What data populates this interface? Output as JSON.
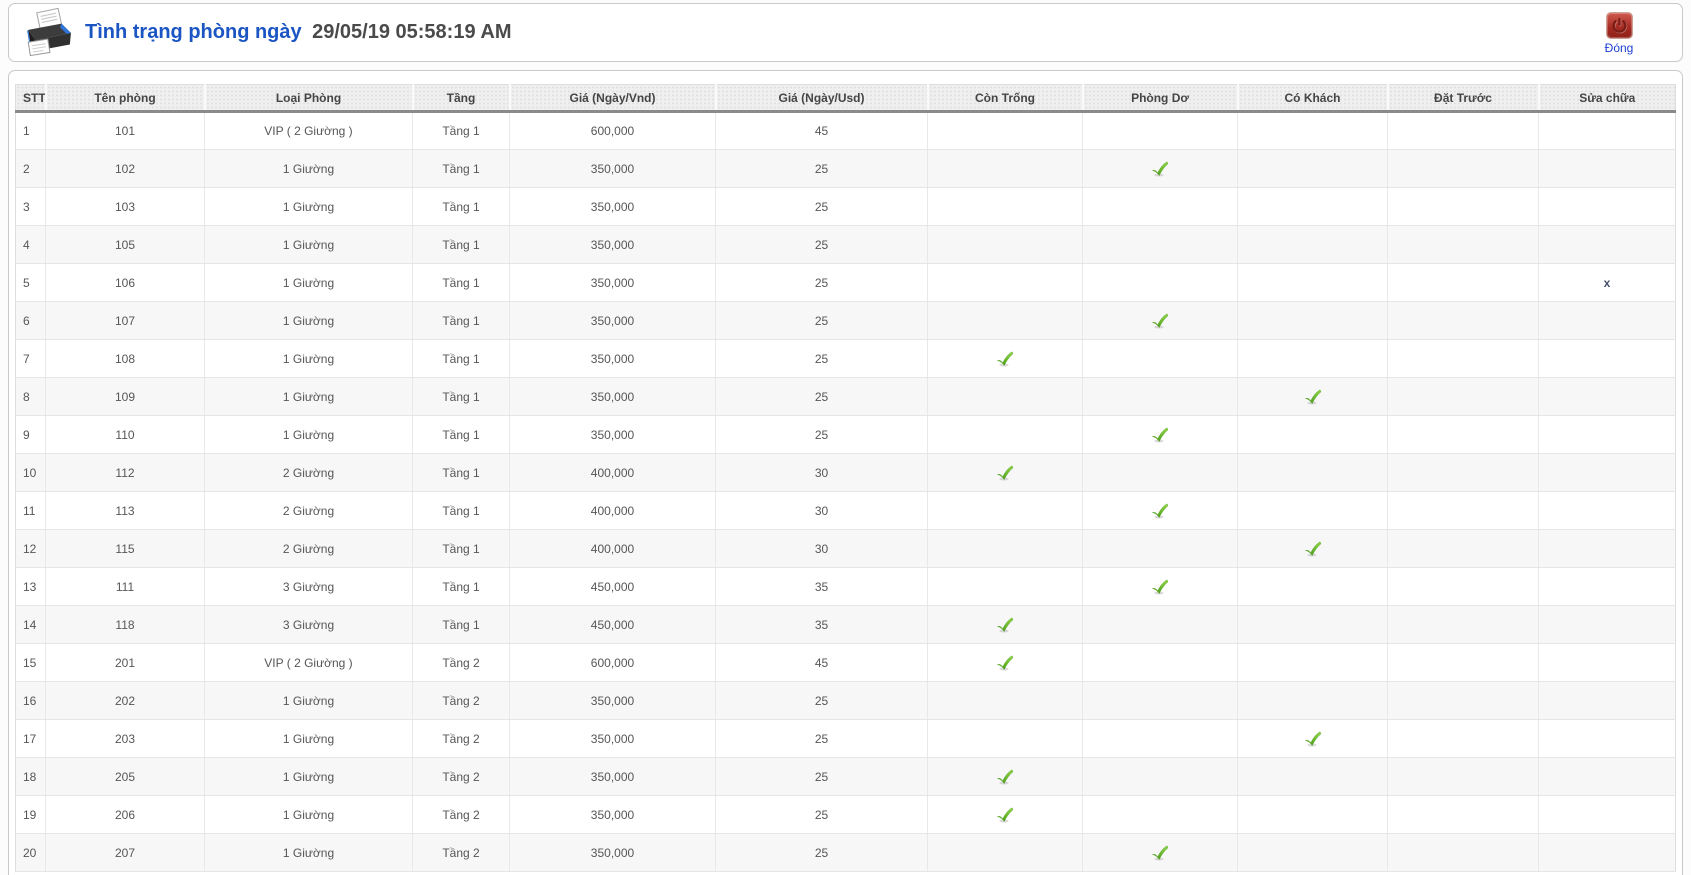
{
  "header": {
    "title": "Tình trạng phòng ngày",
    "datetime": "29/05/19 05:58:19 AM",
    "close_label": "Đóng"
  },
  "table": {
    "columns": [
      "STT",
      "Tên phòng",
      "Loại Phòng",
      "Tầng",
      "Giá (Ngày/Vnd)",
      "Giá (Ngày/Usd)",
      "Còn Trống",
      "Phòng Dơ",
      "Có Khách",
      "Đặt Trước",
      "Sửa chữa"
    ],
    "status_keys": [
      "vacant",
      "dirty",
      "occupied",
      "reserved",
      "repair"
    ],
    "repair_mark": "x",
    "rows": [
      {
        "stt": "1",
        "room": "101",
        "type": "VIP ( 2 Giường )",
        "floor": "Tầng 1",
        "price_vnd": "600,000",
        "price_usd": "45",
        "status": ""
      },
      {
        "stt": "2",
        "room": "102",
        "type": "1 Giường",
        "floor": "Tầng 1",
        "price_vnd": "350,000",
        "price_usd": "25",
        "status": "dirty"
      },
      {
        "stt": "3",
        "room": "103",
        "type": "1 Giường",
        "floor": "Tầng 1",
        "price_vnd": "350,000",
        "price_usd": "25",
        "status": ""
      },
      {
        "stt": "4",
        "room": "105",
        "type": "1 Giường",
        "floor": "Tầng 1",
        "price_vnd": "350,000",
        "price_usd": "25",
        "status": ""
      },
      {
        "stt": "5",
        "room": "106",
        "type": "1 Giường",
        "floor": "Tầng 1",
        "price_vnd": "350,000",
        "price_usd": "25",
        "status": "repair"
      },
      {
        "stt": "6",
        "room": "107",
        "type": "1 Giường",
        "floor": "Tầng 1",
        "price_vnd": "350,000",
        "price_usd": "25",
        "status": "dirty"
      },
      {
        "stt": "7",
        "room": "108",
        "type": "1 Giường",
        "floor": "Tầng 1",
        "price_vnd": "350,000",
        "price_usd": "25",
        "status": "vacant"
      },
      {
        "stt": "8",
        "room": "109",
        "type": "1 Giường",
        "floor": "Tầng 1",
        "price_vnd": "350,000",
        "price_usd": "25",
        "status": "occupied"
      },
      {
        "stt": "9",
        "room": "110",
        "type": "1 Giường",
        "floor": "Tầng 1",
        "price_vnd": "350,000",
        "price_usd": "25",
        "status": "dirty"
      },
      {
        "stt": "10",
        "room": "112",
        "type": "2 Giường",
        "floor": "Tầng 1",
        "price_vnd": "400,000",
        "price_usd": "30",
        "status": "vacant"
      },
      {
        "stt": "11",
        "room": "113",
        "type": "2 Giường",
        "floor": "Tầng 1",
        "price_vnd": "400,000",
        "price_usd": "30",
        "status": "dirty"
      },
      {
        "stt": "12",
        "room": "115",
        "type": "2 Giường",
        "floor": "Tầng 1",
        "price_vnd": "400,000",
        "price_usd": "30",
        "status": "occupied"
      },
      {
        "stt": "13",
        "room": "111",
        "type": "3 Giường",
        "floor": "Tầng 1",
        "price_vnd": "450,000",
        "price_usd": "35",
        "status": "dirty"
      },
      {
        "stt": "14",
        "room": "118",
        "type": "3 Giường",
        "floor": "Tầng 1",
        "price_vnd": "450,000",
        "price_usd": "35",
        "status": "vacant"
      },
      {
        "stt": "15",
        "room": "201",
        "type": "VIP ( 2 Giường )",
        "floor": "Tầng 2",
        "price_vnd": "600,000",
        "price_usd": "45",
        "status": "vacant"
      },
      {
        "stt": "16",
        "room": "202",
        "type": "1 Giường",
        "floor": "Tầng 2",
        "price_vnd": "350,000",
        "price_usd": "25",
        "status": ""
      },
      {
        "stt": "17",
        "room": "203",
        "type": "1 Giường",
        "floor": "Tầng 2",
        "price_vnd": "350,000",
        "price_usd": "25",
        "status": "occupied"
      },
      {
        "stt": "18",
        "room": "205",
        "type": "1 Giường",
        "floor": "Tầng 2",
        "price_vnd": "350,000",
        "price_usd": "25",
        "status": "vacant"
      },
      {
        "stt": "19",
        "room": "206",
        "type": "1 Giường",
        "floor": "Tầng 2",
        "price_vnd": "350,000",
        "price_usd": "25",
        "status": "vacant"
      },
      {
        "stt": "20",
        "room": "207",
        "type": "1 Giường",
        "floor": "Tầng 2",
        "price_vnd": "350,000",
        "price_usd": "25",
        "status": "dirty"
      }
    ]
  },
  "colors": {
    "title_blue": "#1b55c4",
    "link_blue": "#1f3fd0",
    "check_green": "#5fae27",
    "close_red": "#a42a20",
    "header_border": "#8a8a8a"
  }
}
